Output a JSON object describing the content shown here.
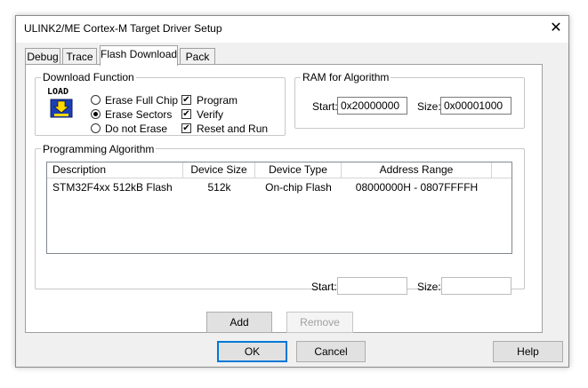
{
  "window": {
    "title": "ULINK2/ME Cortex-M Target Driver Setup"
  },
  "tabs": [
    {
      "label": "Debug"
    },
    {
      "label": "Trace"
    },
    {
      "label": "Flash Download"
    },
    {
      "label": "Pack"
    }
  ],
  "download_function": {
    "label": "Download Function",
    "icon_text": "LOAD",
    "radios": [
      {
        "label": "Erase Full Chip",
        "selected": false
      },
      {
        "label": "Erase Sectors",
        "selected": true
      },
      {
        "label": "Do not Erase",
        "selected": false
      }
    ],
    "checks": [
      {
        "label": "Program",
        "checked": true
      },
      {
        "label": "Verify",
        "checked": true
      },
      {
        "label": "Reset and Run",
        "checked": true
      }
    ],
    "check_mark": "✔"
  },
  "ram": {
    "label": "RAM for Algorithm",
    "start_label": "Start:",
    "start_value": "0x20000000",
    "size_label": "Size:",
    "size_value": "0x00001000"
  },
  "algorithm": {
    "label": "Programming Algorithm",
    "columns": [
      "Description",
      "Device Size",
      "Device Type",
      "Address Range"
    ],
    "rows": [
      [
        "STM32F4xx 512kB Flash",
        "512k",
        "On-chip Flash",
        "08000000H - 0807FFFFH"
      ]
    ],
    "start_label": "Start:",
    "start_value": "",
    "size_label": "Size:",
    "size_value": ""
  },
  "actions": {
    "add": "Add",
    "remove": "Remove"
  },
  "footer": {
    "ok": "OK",
    "cancel": "Cancel",
    "help": "Help"
  },
  "close_glyph": "✕",
  "colors": {
    "default_button_border": "#0078d7",
    "icon_blue": "#1b3fb5",
    "icon_yellow": "#ffd800"
  }
}
